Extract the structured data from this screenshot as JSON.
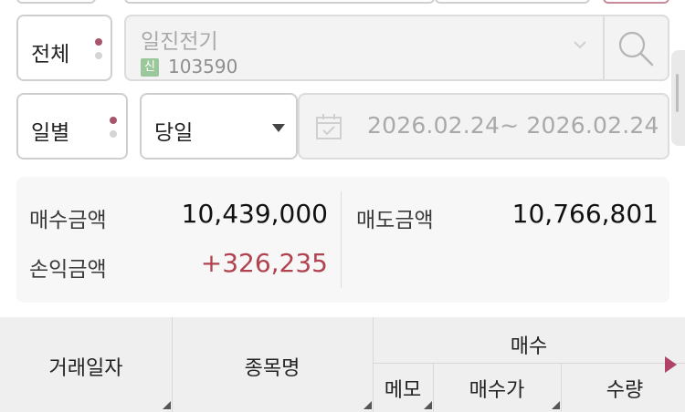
{
  "account_filter": {
    "label": "전체"
  },
  "stock": {
    "name": "일진전기",
    "badge": "신",
    "code": "103590"
  },
  "period_filter": {
    "label": "일별"
  },
  "period_select": {
    "value": "당일"
  },
  "date_range": {
    "text": "2026.02.24~ 2026.02.24"
  },
  "summary": {
    "buy_amount_label": "매수금액",
    "buy_amount_value": "10,439,000",
    "sell_amount_label": "매도금액",
    "sell_amount_value": "10,766,801",
    "pl_amount_label": "손익금액",
    "pl_amount_value": "+326,235"
  },
  "table": {
    "col_trade_date": "거래일자",
    "col_stock_name": "종목명",
    "group_buy": "매수",
    "col_memo": "메모",
    "col_buy_price": "매수가",
    "col_quantity": "수량"
  },
  "colors": {
    "accent": "#a5566c",
    "positive": "#b0434f",
    "badge": "#9bc89b"
  },
  "icons": [
    "chevron-down-icon",
    "search-icon",
    "calendar-icon",
    "dropdown-arrow-icon",
    "scroll-right-icon"
  ]
}
